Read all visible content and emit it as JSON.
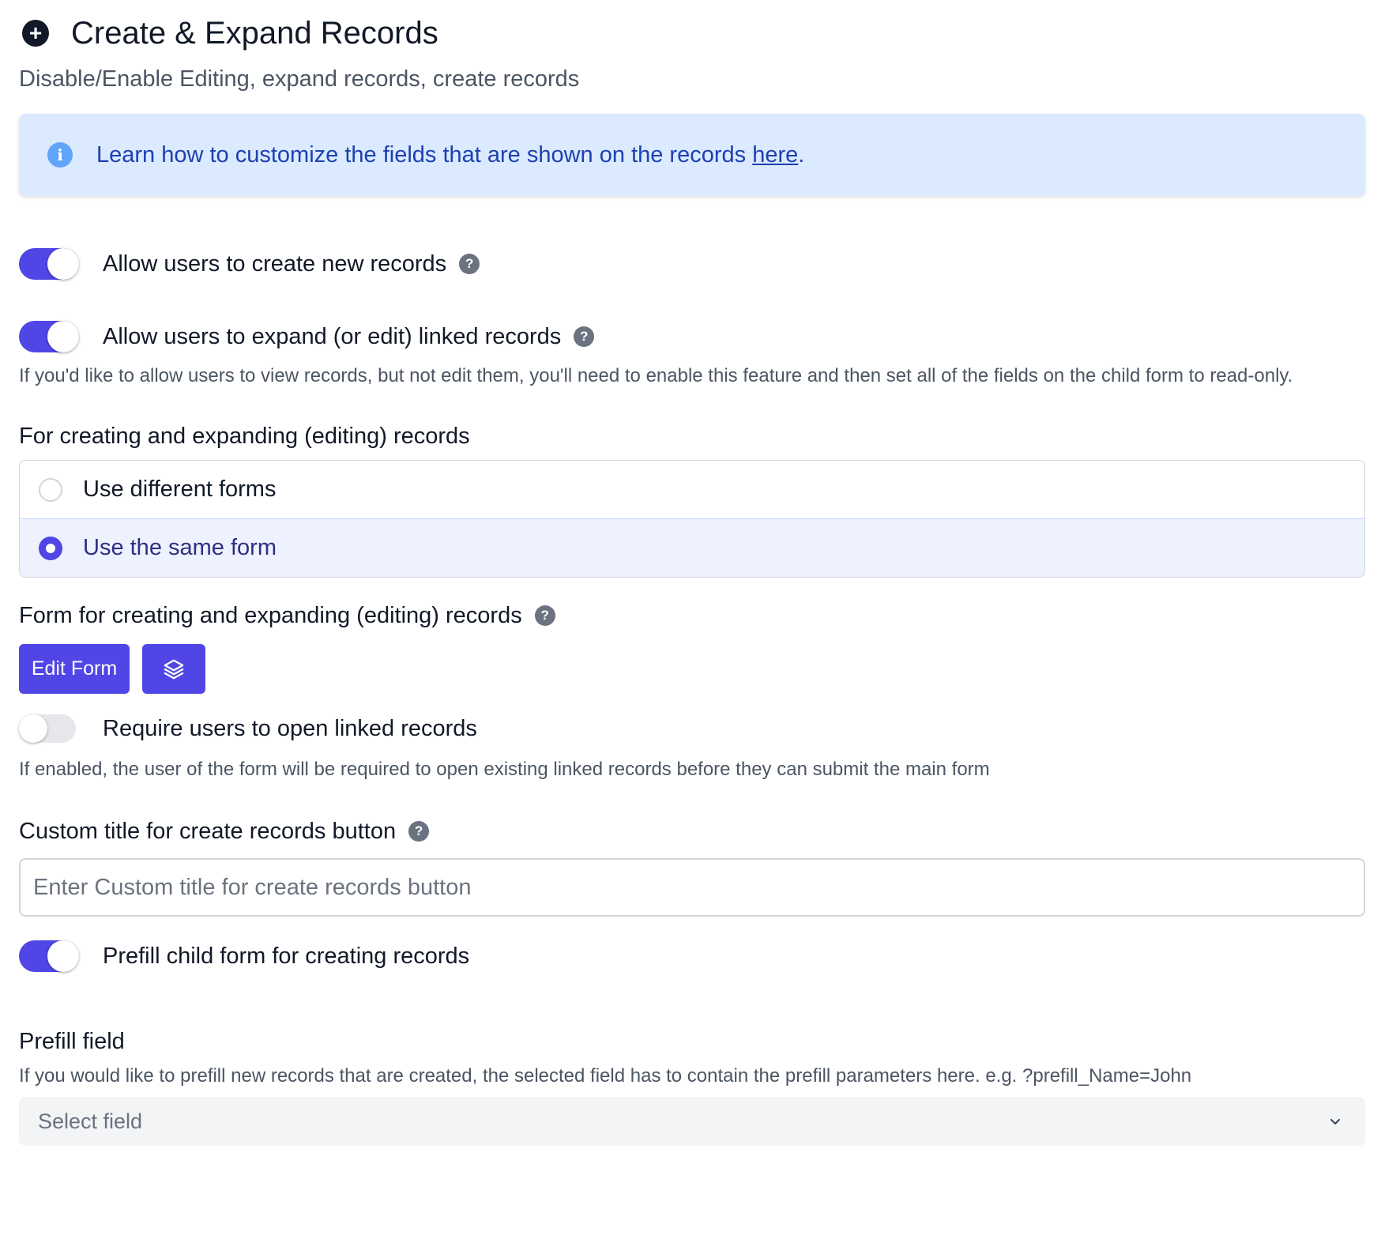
{
  "header": {
    "icon": "plus-circle-icon",
    "title": "Create & Expand Records",
    "subtitle": "Disable/Enable Editing, expand records, create records"
  },
  "info": {
    "icon": "info-icon",
    "text": "Learn how to customize the fields that are shown on the records ",
    "link_text": "here",
    "suffix": "."
  },
  "settings": {
    "create_new": {
      "label": "Allow users to create new records",
      "enabled": true
    },
    "expand_linked": {
      "label": "Allow users to expand (or edit) linked records",
      "enabled": true,
      "helper": "If you'd like to allow users to view records, but not edit them, you'll need to enable this feature and then set all of the fields on the child form to read-only."
    },
    "forms_choice": {
      "label": "For creating and expanding (editing) records",
      "options": [
        {
          "label": "Use different forms",
          "selected": false
        },
        {
          "label": "Use the same form",
          "selected": true
        }
      ]
    },
    "form_picker": {
      "label": "Form for creating and expanding (editing) records",
      "edit_button": "Edit Form",
      "layers_icon": "layers-icon"
    },
    "require_open": {
      "label": "Require users to open linked records",
      "enabled": false,
      "helper": "If enabled, the user of the form will be required to open existing linked records before they can submit the main form"
    },
    "custom_title": {
      "label": "Custom title for create records button",
      "placeholder": "Enter Custom title for create records button",
      "value": ""
    },
    "prefill_child": {
      "label": "Prefill child form for creating records",
      "enabled": true
    },
    "prefill_field": {
      "label": "Prefill field",
      "helper": "If you would like to prefill new records that are created, the selected field has to contain the prefill parameters here. e.g. ?prefill_Name=John",
      "select_value": "Select field"
    }
  },
  "colors": {
    "accent": "#4f46e5",
    "info_bg": "#dbeafe",
    "info_text": "#1e40af"
  }
}
